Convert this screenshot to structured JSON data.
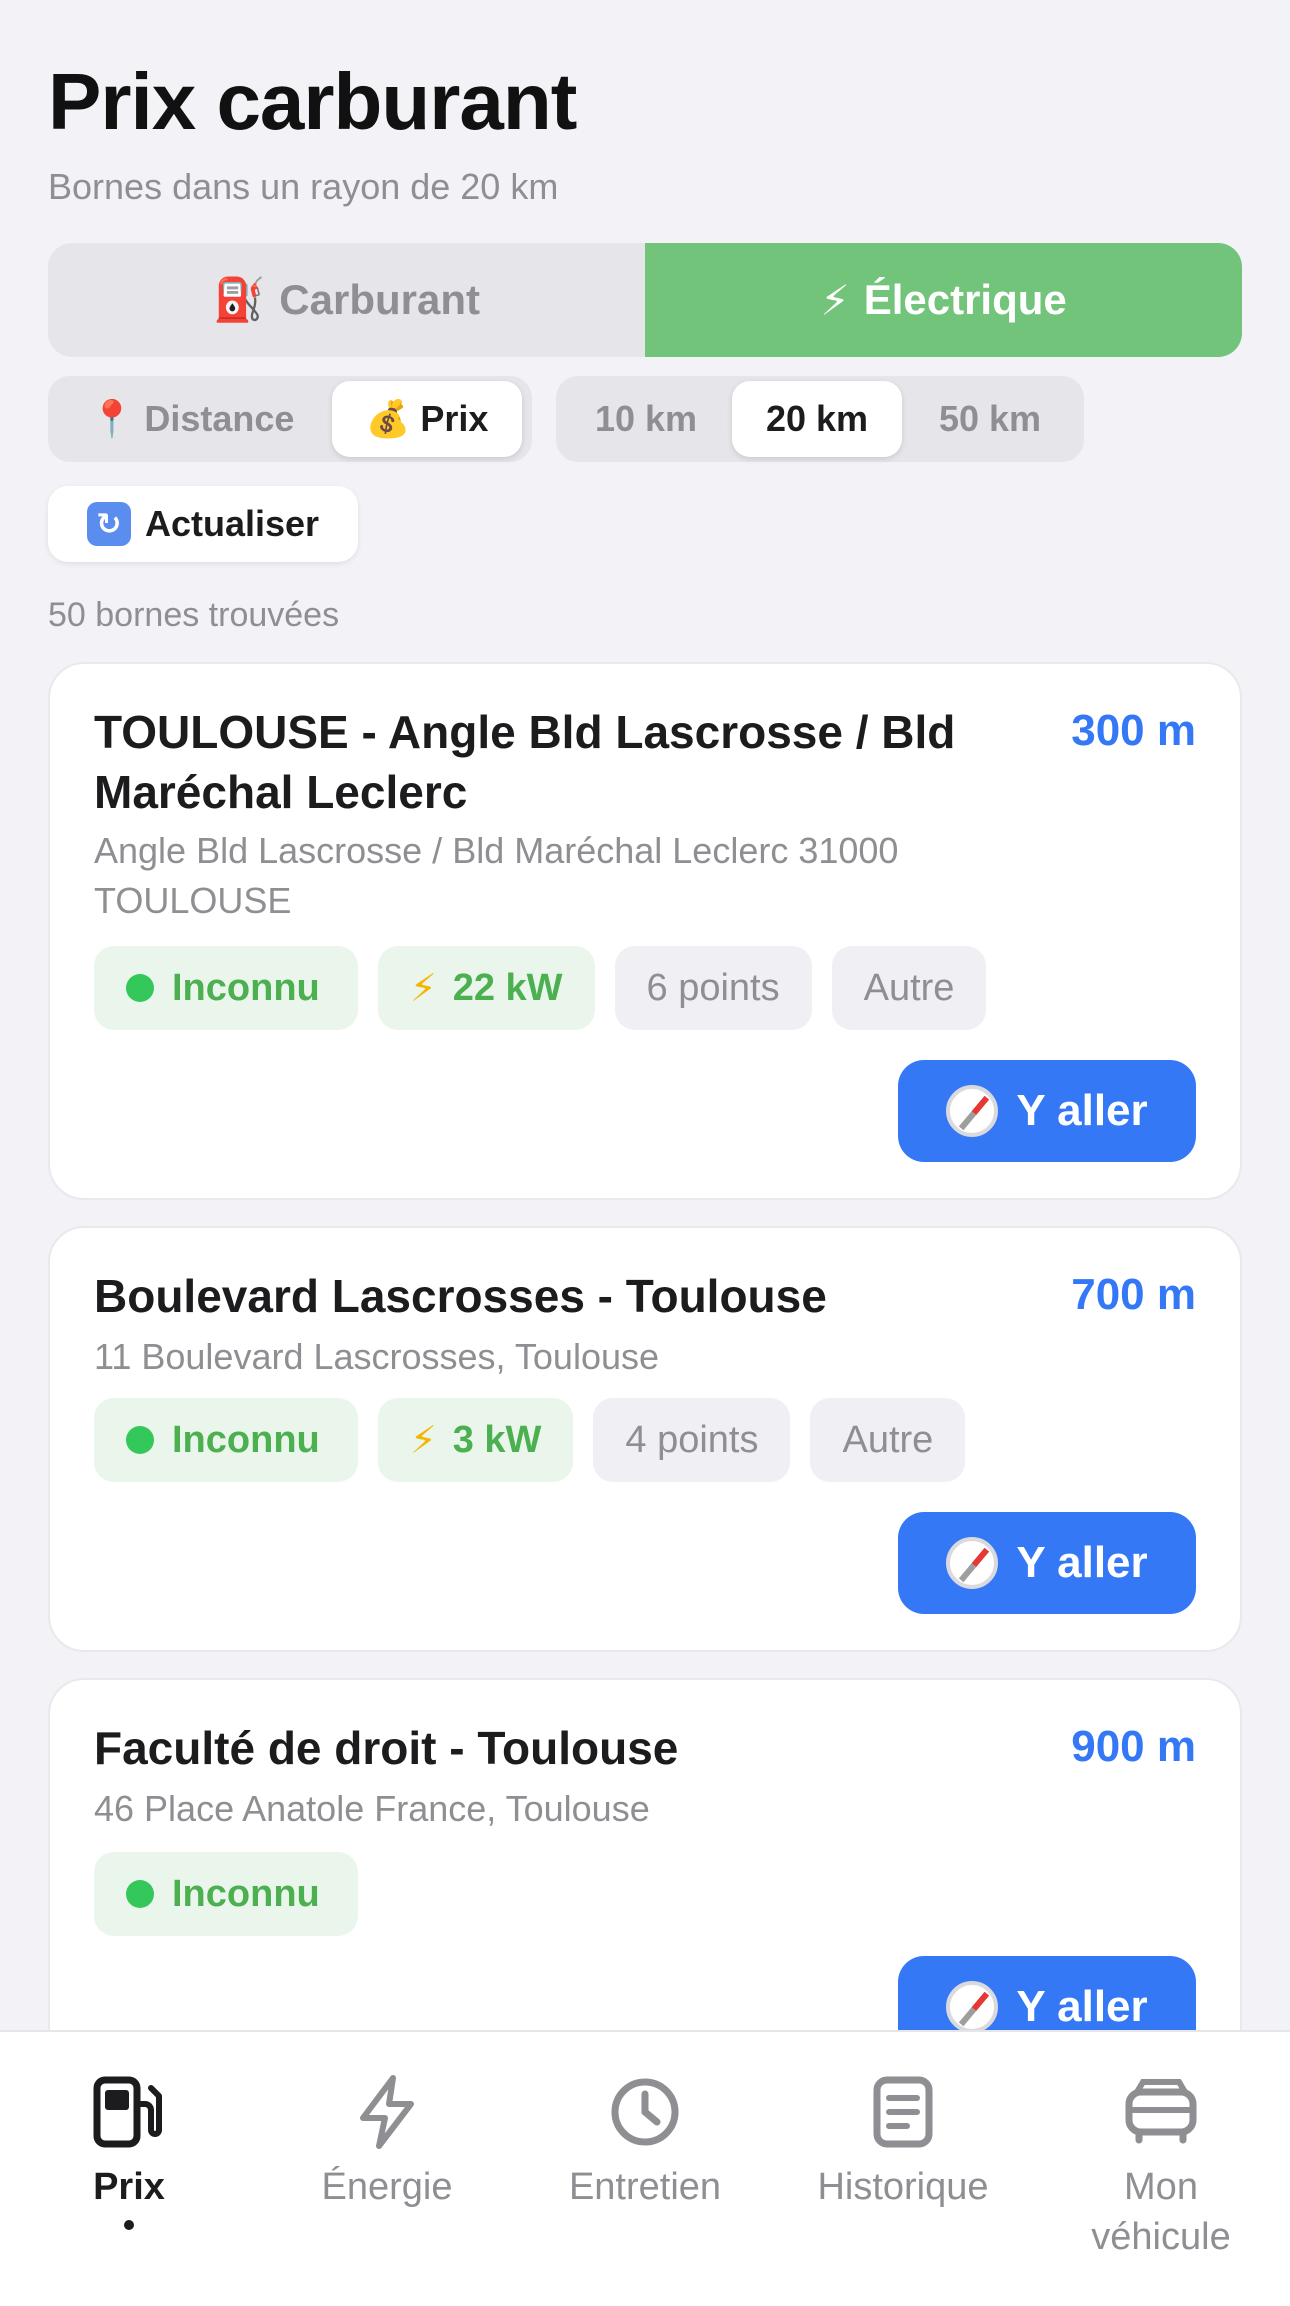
{
  "header": {
    "title": "Prix carburant",
    "subtitle": "Bornes dans un rayon de 20 km"
  },
  "fuel_type": {
    "options": [
      {
        "label": "Carburant",
        "icon": "fuel-pump-icon",
        "emoji": "⛽"
      },
      {
        "label": "Électrique",
        "icon": "bolt-icon",
        "emoji": "⚡"
      }
    ],
    "selected": "Électrique",
    "active_color": "#71C47A"
  },
  "sort": {
    "options": [
      {
        "label": "Distance",
        "emoji": "📍",
        "icon": "pin-icon"
      },
      {
        "label": "Prix",
        "emoji": "💰",
        "icon": "money-bag-icon"
      }
    ],
    "selected": "Prix"
  },
  "radius": {
    "options": [
      "10 km",
      "20 km",
      "50 km"
    ],
    "selected": "20 km"
  },
  "refresh": {
    "label": "Actualiser",
    "emoji": "🔄",
    "icon": "refresh-icon"
  },
  "results": {
    "count_text": "50 bornes trouvées"
  },
  "stations": [
    {
      "name": "TOULOUSE - Angle Bld Lascrosse / Bld Maréchal Leclerc",
      "distance": "300 m",
      "address": "Angle Bld Lascrosse / Bld Maréchal Leclerc 31000 TOULOUSE",
      "status": "Inconnu",
      "power": "22 kW",
      "points": "6 points",
      "type": "Autre",
      "action": "Y aller"
    },
    {
      "name": "Boulevard Lascrosses - Toulouse",
      "distance": "700 m",
      "address": "11 Boulevard Lascrosses, Toulouse",
      "status": "Inconnu",
      "power": "3 kW",
      "points": "4 points",
      "type": "Autre",
      "action": "Y aller"
    },
    {
      "name": "Faculté de droit - Toulouse",
      "distance": "900 m",
      "address": "46 Place Anatole France, Toulouse",
      "status": "Inconnu",
      "action": "Y aller"
    }
  ],
  "tabbar": {
    "items": [
      {
        "label": "Prix",
        "icon": "fuel-station-icon"
      },
      {
        "label": "Énergie",
        "icon": "bolt-icon"
      },
      {
        "label": "Entretien",
        "icon": "clock-icon"
      },
      {
        "label": "Historique",
        "icon": "document-icon"
      },
      {
        "label": "Mon véhicule",
        "icon": "car-icon"
      }
    ],
    "selected": "Prix"
  },
  "colors": {
    "accent_blue": "#3478F6",
    "status_green": "#4CAF50",
    "background": "#F2F2F7"
  }
}
